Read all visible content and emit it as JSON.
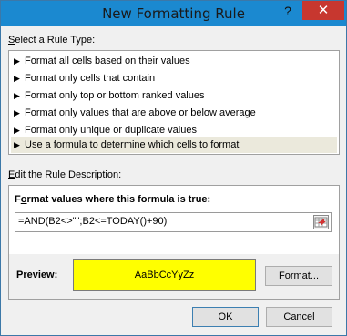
{
  "window": {
    "title": "New Formatting Rule",
    "help_label": "?",
    "close_label": "✕"
  },
  "rule_type": {
    "label": "elect a Rule Type:",
    "label_mnemonic": "S",
    "items": [
      "Format all cells based on their values",
      "Format only cells that contain",
      "Format only top or bottom ranked values",
      "Format only values that are above or below average",
      "Format only unique or duplicate values",
      "Use a formula to determine which cells to format"
    ],
    "selected_index": 5
  },
  "rule_description": {
    "label": "dit the Rule Description:",
    "label_mnemonic": "E",
    "formula_label": "rmat values where this formula is true:",
    "formula_label_plain": "F",
    "formula_label_mnemonic": "o",
    "formula_value": "=AND(B2<>\"\";B2<=TODAY()+90)"
  },
  "preview": {
    "label": "Preview:",
    "sample_text": "AaBbCcYyZz",
    "fill_color": "#ffff00"
  },
  "buttons": {
    "format": "ormat...",
    "format_mnemonic": "F",
    "ok": "OK",
    "cancel": "Cancel"
  },
  "icons": {
    "bullet": "▶",
    "collapse": "range-select-icon"
  }
}
